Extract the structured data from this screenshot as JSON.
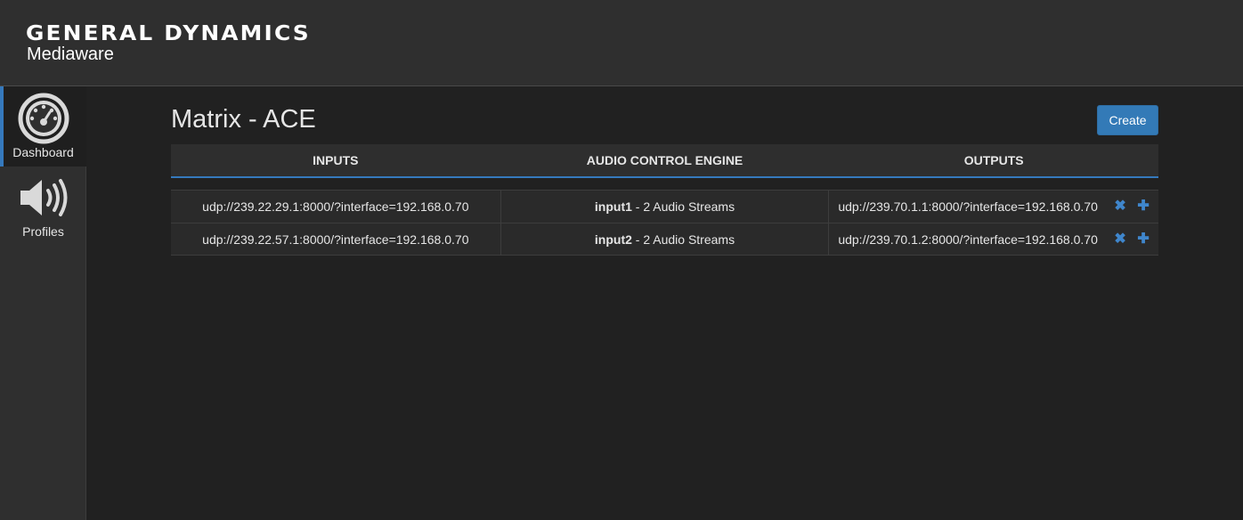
{
  "header": {
    "brand": "GENERAL DYNAMICS",
    "sub_brand": "Mediaware"
  },
  "sidebar": {
    "items": [
      {
        "label": "Dashboard",
        "icon": "dashboard-icon",
        "active": true
      },
      {
        "label": "Profiles",
        "icon": "speaker-icon",
        "active": false
      }
    ]
  },
  "main": {
    "title": "Matrix - ACE",
    "create_label": "Create",
    "columns": [
      "INPUTS",
      "AUDIO CONTROL ENGINE",
      "OUTPUTS"
    ],
    "rows": [
      {
        "input": "udp://239.22.29.1:8000/?interface=192.168.0.70",
        "engine_name": "input1",
        "engine_desc": " - 2 Audio Streams",
        "output": "udp://239.70.1.1:8000/?interface=192.168.0.70"
      },
      {
        "input": "udp://239.22.57.1:8000/?interface=192.168.0.70",
        "engine_name": "input2",
        "engine_desc": " - 2 Audio Streams",
        "output": "udp://239.70.1.2:8000/?interface=192.168.0.70"
      }
    ],
    "remove_glyph": "✖",
    "add_glyph": "✚"
  },
  "colors": {
    "accent": "#337ab7",
    "background": "#212121",
    "panel": "#2f2f2f"
  }
}
